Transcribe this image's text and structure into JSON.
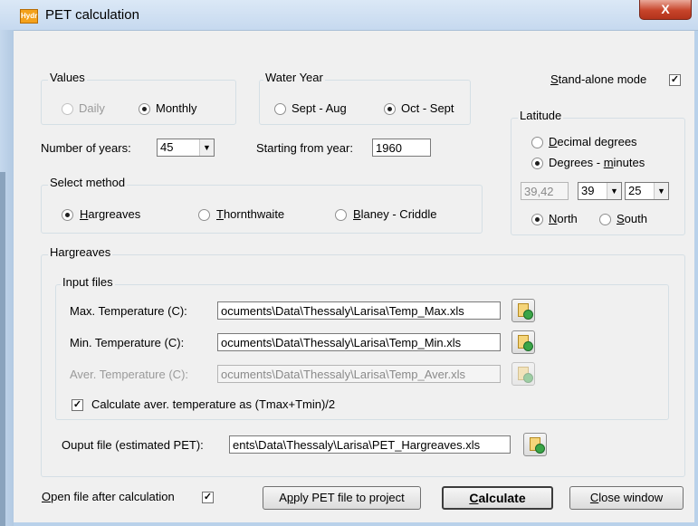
{
  "window": {
    "title": "PET calculation",
    "close": "X",
    "app_icon_text": "Hydr"
  },
  "values": {
    "title": "Values",
    "options": [
      "Daily",
      "Monthly"
    ],
    "selected": "Monthly"
  },
  "water_year": {
    "title": "Water Year",
    "options": [
      "Sept - Aug",
      "Oct - Sept"
    ],
    "selected": "Oct - Sept"
  },
  "standalone": {
    "label": "Stand-alone mode",
    "checked": true
  },
  "latitude": {
    "title": "Latitude",
    "options": [
      "Decimal degrees",
      "Degrees - minutes"
    ],
    "selected": "Degrees - minutes",
    "decimal_value": "39,42",
    "degrees": "39",
    "minutes": "25",
    "hemisphere_options": [
      "North",
      "South"
    ],
    "hemisphere_selected": "North"
  },
  "years": {
    "label": "Number of years:",
    "value": "45"
  },
  "start": {
    "label": "Starting from year:",
    "value": "1960"
  },
  "method": {
    "title": "Select method",
    "options": [
      "Hargreaves",
      "Thornthwaite",
      "Blaney - Criddle"
    ],
    "selected": "Hargreaves"
  },
  "hargreaves": {
    "title": "Hargreaves",
    "input_title": "Input files",
    "max_label": "Max. Temperature (C):",
    "max_value": "ocuments\\Data\\Thessaly\\Larisa\\Temp_Max.xls",
    "min_label": "Min. Temperature (C):",
    "min_value": "ocuments\\Data\\Thessaly\\Larisa\\Temp_Min.xls",
    "aver_label": "Aver. Temperature (C):",
    "aver_value": "ocuments\\Data\\Thessaly\\Larisa\\Temp_Aver.xls",
    "calc_aver_label": "Calculate aver. temperature as (Tmax+Tmin)/2",
    "calc_aver_checked": true,
    "output_label": "Ouput file (estimated PET):",
    "output_value": "ents\\Data\\Thessaly\\Larisa\\PET_Hargreaves.xls"
  },
  "footer": {
    "open_after_label": "Open file after calculation",
    "open_after_checked": true,
    "apply_label": "Apply PET file to project",
    "calculate_label": "Calculate",
    "close_label": "Close window"
  },
  "check_mark": "✓",
  "arrow_glyph": "▼"
}
